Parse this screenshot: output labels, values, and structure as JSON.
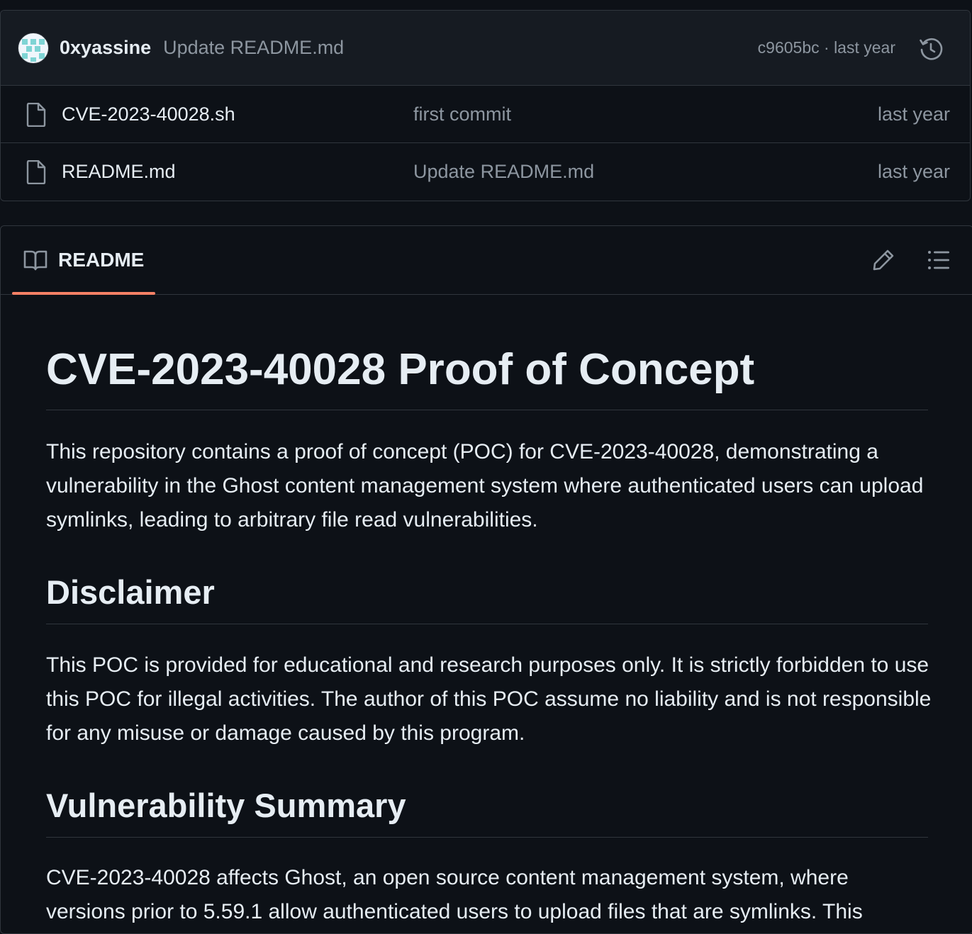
{
  "latest_commit": {
    "author": "0xyassine",
    "message": "Update README.md",
    "meta": "c9605bc · last year"
  },
  "files": [
    {
      "name": "CVE-2023-40028.sh",
      "commit": "first commit",
      "time": "last year"
    },
    {
      "name": "README.md",
      "commit": "Update README.md",
      "time": "last year"
    }
  ],
  "readme": {
    "tab_label": "README",
    "title": "CVE-2023-40028 Proof of Concept",
    "intro": "This repository contains a proof of concept (POC) for CVE-2023-40028, demonstrating a vulnerability in the Ghost content management system where authenticated users can upload symlinks, leading to arbitrary file read vulnerabilities.",
    "disclaimer_heading": "Disclaimer",
    "disclaimer_text": "This POC is provided for educational and research purposes only. It is strictly forbidden to use this POC for illegal activities. The author of this POC assume no liability and is not responsible for any misuse or damage caused by this program.",
    "summary_heading": "Vulnerability Summary",
    "summary_text": "CVE-2023-40028 affects Ghost, an open source content management system, where versions prior to 5.59.1 allow authenticated users to upload files that are symlinks. This"
  },
  "colors": {
    "background": "#0d1117",
    "header_background": "#161b22",
    "border": "#30363d",
    "text": "#e6edf3",
    "muted": "#8d96a0",
    "tab_underline": "#f78166"
  },
  "icons": {
    "avatar": "avatar",
    "history": "history-icon",
    "file": "file-icon",
    "book": "book-icon",
    "edit": "pencil-icon",
    "outline": "list-icon"
  }
}
